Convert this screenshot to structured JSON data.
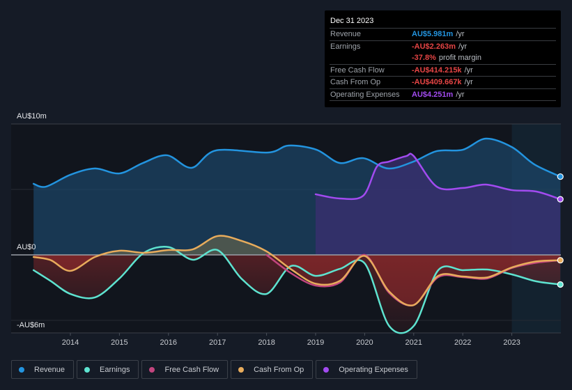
{
  "tooltip": {
    "date": "Dec 31 2023",
    "rows": [
      {
        "key": "Revenue",
        "value": "AU$5.981m",
        "unit": "/yr",
        "color": "#2394df"
      },
      {
        "key": "Earnings",
        "value": "-AU$2.263m",
        "unit": "/yr",
        "color": "#e64545"
      },
      {
        "key": "",
        "value": "-37.8%",
        "unit": "profit margin",
        "color": "#e64545"
      },
      {
        "key": "Free Cash Flow",
        "value": "-AU$414.215k",
        "unit": "/yr",
        "color": "#e64545"
      },
      {
        "key": "Cash From Op",
        "value": "-AU$409.667k",
        "unit": "/yr",
        "color": "#e64545"
      },
      {
        "key": "Operating Expenses",
        "value": "AU$4.251m",
        "unit": "/yr",
        "color": "#a24bf0"
      }
    ]
  },
  "legend": [
    {
      "label": "Revenue",
      "color": "#2394df"
    },
    {
      "label": "Earnings",
      "color": "#5ee3d0"
    },
    {
      "label": "Free Cash Flow",
      "color": "#c2457e"
    },
    {
      "label": "Cash From Op",
      "color": "#e8ac5c"
    },
    {
      "label": "Operating Expenses",
      "color": "#a24bf0"
    }
  ],
  "chart_data": {
    "type": "line",
    "title": "",
    "xlabel": "",
    "ylabel": "",
    "y_unit": "AU$ millions",
    "ylim": [
      -6,
      10
    ],
    "xlim": [
      2013.25,
      2024.0
    ],
    "y_tick_labels": [
      {
        "value": 10,
        "label": "AU$10m"
      },
      {
        "value": 0,
        "label": "AU$0"
      },
      {
        "value": -6,
        "label": "-AU$6m"
      }
    ],
    "x_tick_labels": [
      "2014",
      "2015",
      "2016",
      "2017",
      "2018",
      "2019",
      "2020",
      "2021",
      "2022",
      "2023"
    ],
    "x_ticks": [
      2014,
      2015,
      2016,
      2017,
      2018,
      2019,
      2020,
      2021,
      2022,
      2023
    ],
    "forecast_shade_from": 2023.0,
    "grid": true,
    "series": [
      {
        "name": "Revenue",
        "color": "#2394df",
        "x": [
          2013.25,
          2013.5,
          2014.0,
          2014.5,
          2015.0,
          2015.48,
          2015.97,
          2016.47,
          2016.97,
          2018.03,
          2018.45,
          2019.02,
          2019.49,
          2019.97,
          2020.48,
          2021.0,
          2021.47,
          2022.0,
          2022.47,
          2023.0,
          2023.46,
          2023.99
        ],
        "y": [
          5.43,
          5.21,
          6.12,
          6.6,
          6.22,
          7.02,
          7.61,
          6.65,
          7.98,
          7.82,
          8.35,
          8.03,
          7.02,
          7.39,
          6.6,
          7.13,
          7.93,
          8.03,
          8.88,
          8.24,
          6.91,
          5.98
        ]
      },
      {
        "name": "Earnings",
        "color": "#5ee3d0",
        "x": [
          2013.25,
          2013.6,
          2014.0,
          2014.5,
          2015.0,
          2015.5,
          2016.0,
          2016.5,
          2017.0,
          2017.5,
          2018.0,
          2018.5,
          2019.0,
          2019.5,
          2020.0,
          2020.5,
          2021.0,
          2021.5,
          2022.0,
          2022.5,
          2023.0,
          2023.5,
          2023.99
        ],
        "y": [
          -1.17,
          -2.0,
          -2.98,
          -3.25,
          -1.8,
          0.16,
          0.6,
          -0.37,
          0.37,
          -1.86,
          -2.98,
          -0.85,
          -1.6,
          -1.06,
          -0.64,
          -5.43,
          -5.43,
          -1.17,
          -1.17,
          -1.12,
          -1.49,
          -2.02,
          -2.26
        ]
      },
      {
        "name": "Free Cash Flow",
        "color": "#c2457e",
        "x": [
          2018.0,
          2018.5,
          2019.0,
          2019.5,
          2020.0,
          2020.5,
          2021.0,
          2021.5,
          2022.0,
          2022.5,
          2023.0,
          2023.5,
          2023.99
        ],
        "y": [
          0.0,
          -1.4,
          -2.34,
          -2.1,
          0.0,
          -2.9,
          -3.83,
          -1.7,
          -1.7,
          -1.8,
          -1.0,
          -0.6,
          -0.41
        ]
      },
      {
        "name": "Cash From Op",
        "color": "#e8ac5c",
        "x": [
          2013.25,
          2013.6,
          2014.0,
          2014.5,
          2015.0,
          2015.5,
          2016.0,
          2016.5,
          2017.0,
          2017.5,
          2018.0,
          2018.5,
          2019.0,
          2019.5,
          2020.0,
          2020.5,
          2021.0,
          2021.5,
          2022.0,
          2022.5,
          2023.0,
          2023.5,
          2023.99
        ],
        "y": [
          -0.16,
          -0.4,
          -1.22,
          -0.16,
          0.32,
          0.16,
          0.37,
          0.43,
          1.44,
          1.06,
          0.27,
          -1.1,
          -2.2,
          -1.97,
          -0.08,
          -2.8,
          -3.83,
          -1.6,
          -1.65,
          -1.72,
          -0.96,
          -0.5,
          -0.41
        ]
      },
      {
        "name": "Operating Expenses",
        "color": "#a24bf0",
        "x": [
          2019.0,
          2019.49,
          2019.97,
          2020.25,
          2020.5,
          2020.85,
          2021.0,
          2021.47,
          2022.0,
          2022.47,
          2023.0,
          2023.5,
          2023.99
        ],
        "y": [
          4.63,
          4.31,
          4.52,
          6.75,
          7.13,
          7.55,
          7.55,
          5.21,
          5.11,
          5.37,
          4.95,
          4.84,
          4.25
        ]
      }
    ]
  }
}
